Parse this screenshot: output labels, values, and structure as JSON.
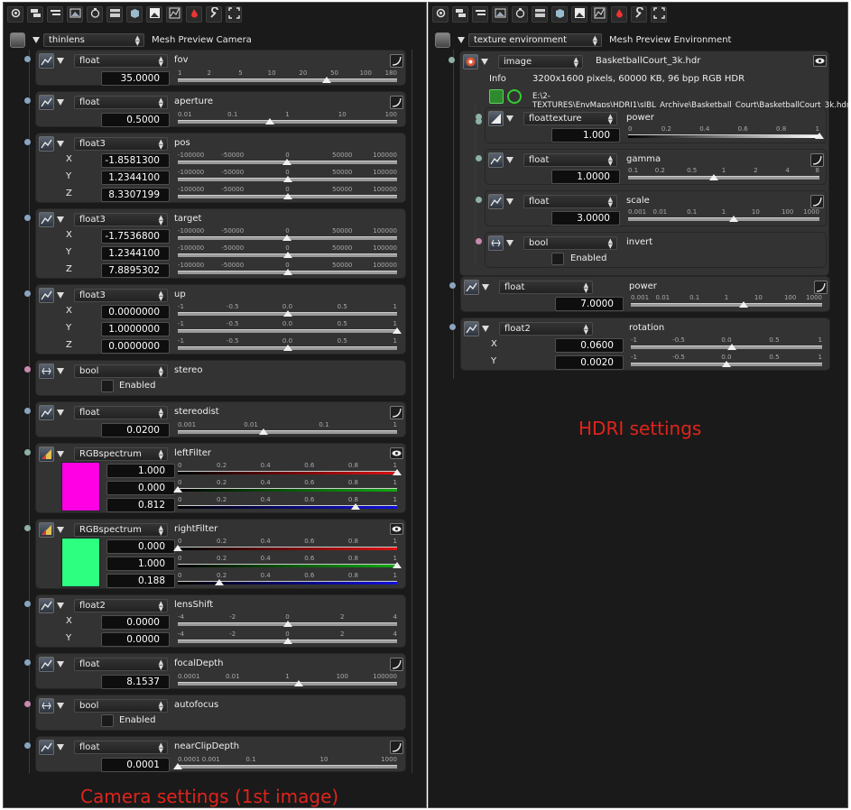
{
  "left": {
    "header": {
      "dropdown": "thinlens",
      "title": "Mesh Preview Camera"
    },
    "caption": "Camera settings (1st image)",
    "nodes": [
      {
        "type": "float",
        "name": "fov",
        "rows": [
          {
            "value": "35.0000"
          }
        ],
        "ticks": [
          "1",
          "2",
          "5",
          "10",
          "20",
          "50",
          "100",
          "180"
        ],
        "thumb": 0.68
      },
      {
        "type": "float",
        "name": "aperture",
        "rows": [
          {
            "value": "0.5000"
          }
        ],
        "ticks": [
          "0.01",
          "0.1",
          "1",
          "10",
          "100"
        ],
        "thumb": 0.42
      },
      {
        "type": "float3",
        "name": "pos",
        "rows": [
          {
            "axis": "X",
            "value": "-1.8581300"
          },
          {
            "axis": "Y",
            "value": "1.2344100"
          },
          {
            "axis": "Z",
            "value": "8.3307199"
          }
        ],
        "ticks": [
          "-100000",
          "-50000",
          "0",
          "50000",
          "100000"
        ]
      },
      {
        "type": "float3",
        "name": "target",
        "rows": [
          {
            "axis": "X",
            "value": "-1.7536800"
          },
          {
            "axis": "Y",
            "value": "1.2344100"
          },
          {
            "axis": "Z",
            "value": "7.8895302"
          }
        ],
        "ticks": [
          "-100000",
          "-50000",
          "0",
          "50000",
          "100000"
        ]
      },
      {
        "type": "float3",
        "name": "up",
        "rows": [
          {
            "axis": "X",
            "value": "0.0000000"
          },
          {
            "axis": "Y",
            "value": "1.0000000"
          },
          {
            "axis": "Z",
            "value": "0.0000000"
          }
        ],
        "ticks": [
          "-1",
          "-0.5",
          "0.0",
          "0.5",
          "1"
        ]
      },
      {
        "type": "bool",
        "name": "stereo",
        "enabled": "Enabled"
      },
      {
        "type": "float",
        "name": "stereodist",
        "rows": [
          {
            "value": "0.0200"
          }
        ],
        "ticks": [
          "0.001",
          "0.01",
          "0.1",
          "1"
        ],
        "thumb": 0.39
      },
      {
        "type": "RGBspectrum",
        "name": "leftFilter",
        "color": "#ff00e5",
        "rows": [
          {
            "value": "1.000"
          },
          {
            "value": "0.000"
          },
          {
            "value": "0.812"
          }
        ],
        "ticks": [
          "0",
          "0.2",
          "0.4",
          "0.6",
          "0.8",
          "1"
        ]
      },
      {
        "type": "RGBspectrum",
        "name": "rightFilter",
        "color": "#2dff80",
        "rows": [
          {
            "value": "0.000"
          },
          {
            "value": "1.000"
          },
          {
            "value": "0.188"
          }
        ],
        "ticks": [
          "0",
          "0.2",
          "0.4",
          "0.6",
          "0.8",
          "1"
        ]
      },
      {
        "type": "float2",
        "name": "lensShift",
        "rows": [
          {
            "axis": "X",
            "value": "0.0000"
          },
          {
            "axis": "Y",
            "value": "0.0000"
          }
        ],
        "ticks": [
          "-4",
          "-2",
          "0",
          "2",
          "4"
        ]
      },
      {
        "type": "float",
        "name": "focalDepth",
        "rows": [
          {
            "value": "8.1537"
          }
        ],
        "ticks": [
          "0.0001",
          "0.01",
          "1",
          "100",
          "100000"
        ],
        "thumb": 0.55
      },
      {
        "type": "bool",
        "name": "autofocus",
        "enabled": "Enabled"
      },
      {
        "type": "float",
        "name": "nearClipDepth",
        "rows": [
          {
            "value": "0.0001"
          }
        ],
        "ticks": [
          "0.0001 0.001",
          "0.1",
          "10",
          "1000"
        ],
        "thumb": 0.0
      }
    ]
  },
  "right": {
    "header": {
      "dropdown": "texture environment",
      "title": "Mesh Preview Environment"
    },
    "caption": "HDRI settings",
    "image": {
      "type": "image",
      "name": "BasketballCourt_3k.hdr",
      "info_label": "Info",
      "info": "3200x1600 pixels, 60000 KB, 96 bpp RGB HDR",
      "path": "E:\\2-TEXTURES\\EnvMaps\\HDRI1\\sIBL_Archive\\Basketball_Court\\BasketballCourt_3k.hdr"
    },
    "sub": [
      {
        "type": "floattexture",
        "name": "power",
        "value": "1.000",
        "ticks": [
          "0",
          "0.2",
          "0.4",
          "0.6",
          "0.8",
          "1"
        ]
      },
      {
        "type": "float",
        "name": "gamma",
        "value": "1.0000",
        "ticks": [
          "0.1",
          "0.2",
          "0.5",
          "1",
          "2",
          "4",
          "8"
        ],
        "thumb": 0.45
      },
      {
        "type": "float",
        "name": "scale",
        "value": "3.0000",
        "ticks": [
          "0.001",
          "0.01",
          "0.1",
          "1",
          "10",
          "100",
          "1000"
        ],
        "thumb": 0.55
      },
      {
        "type": "bool",
        "name": "invert",
        "enabled": "Enabled"
      }
    ],
    "nodes": [
      {
        "type": "float",
        "name": "power",
        "value": "7.0000",
        "ticks": [
          "0.001",
          "0.01",
          "0.1",
          "1",
          "10",
          "100",
          "1000"
        ],
        "thumb": 0.59
      },
      {
        "type": "float2",
        "name": "rotation",
        "rows": [
          {
            "axis": "X",
            "value": "0.0600"
          },
          {
            "axis": "Y",
            "value": "0.0020"
          }
        ],
        "ticks": [
          "-1",
          "-0.5",
          "0.0",
          "0.5",
          "1"
        ]
      }
    ]
  },
  "icons": [
    "camera-icon",
    "layers-icon",
    "list-icon",
    "image-icon",
    "camera-settings-icon",
    "film-icon",
    "box-icon",
    "picture-icon",
    "graph-icon",
    "paint-icon",
    "wrench-icon",
    "fullscreen-icon"
  ]
}
